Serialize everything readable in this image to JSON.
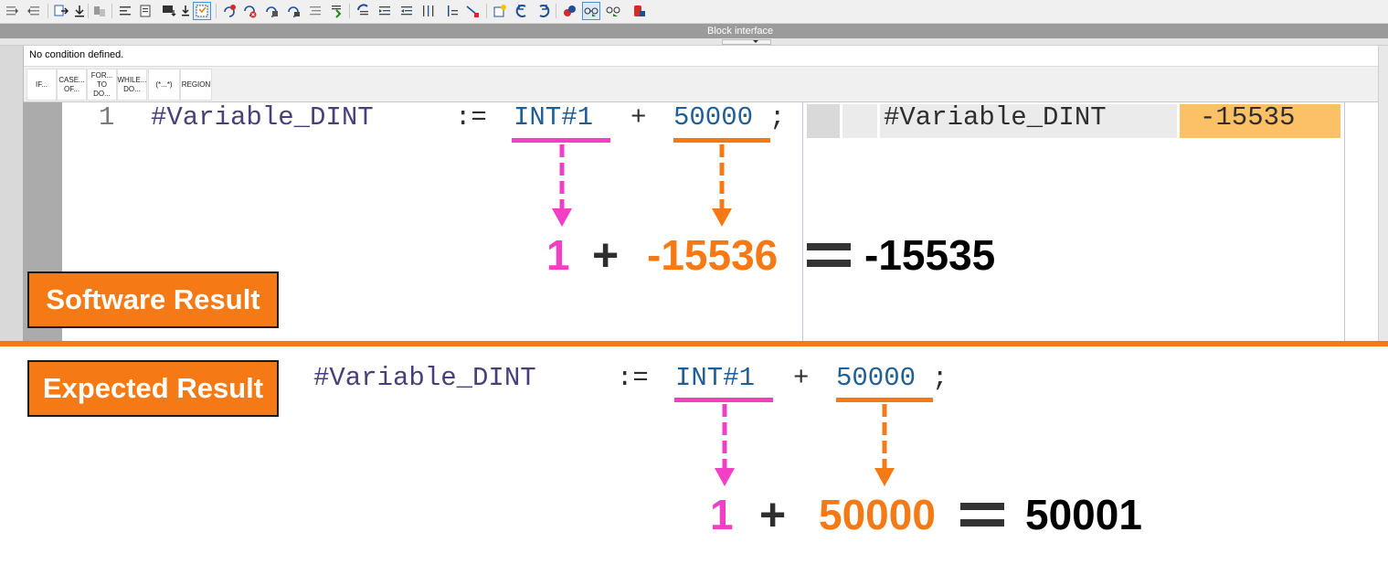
{
  "toolbar": {
    "icons": [
      "indent-increase-icon",
      "indent-decrease-icon",
      "export-icon",
      "compare-icon",
      "align-left-icon",
      "import-block-icon",
      "monitor-download-icon",
      "snippet-select-icon",
      "breakpoint-add-icon",
      "breakpoint-remove-icon",
      "breakpoint-toggle-icon",
      "breakpoint-list-icon",
      "list-icon",
      "step-into-icon",
      "jump-back-icon",
      "jump-forward-icon",
      "indent-icon",
      "outdent-icon",
      "columns-icon",
      "tree-icon",
      "debug-icon",
      "highlight-icon",
      "refresh-icon",
      "back-icon",
      "forward-icon",
      "monitor-icon",
      "watch-icon",
      "watch-table-icon",
      "stop-icon"
    ],
    "active_index": 8
  },
  "panel": {
    "title": "Block interface",
    "condition": "No condition defined."
  },
  "snippets": [
    {
      "line1": "IF...",
      "line2": ""
    },
    {
      "line1": "CASE...",
      "line2": "OF..."
    },
    {
      "line1": "FOR...",
      "line2": "TO DO..."
    },
    {
      "line1": "WHILE...",
      "line2": "DO..."
    },
    {
      "line1": "(*...*)",
      "line2": ""
    },
    {
      "line1": "REGION",
      "line2": ""
    }
  ],
  "code": {
    "line_number": "1",
    "variable": "#Variable_DINT",
    "assign_op": ":=",
    "operand1": "INT#1",
    "plus": "+",
    "operand2": "50000",
    "terminator": ";"
  },
  "watch": {
    "variable": "#Variable_DINT",
    "value": "-15535"
  },
  "software_result": {
    "label": "Software Result",
    "operand1": "1",
    "plus": "+",
    "operand2": "-15536",
    "result": "-15535"
  },
  "expected_result": {
    "label": "Expected Result",
    "operand1": "1",
    "plus": "+",
    "operand2": "50000",
    "result": "50001"
  },
  "colors": {
    "pink": "#f23fc5",
    "orange": "#f57a16",
    "watch_value_bg": "#fcc166",
    "code_variable": "#4b3f7a",
    "code_literal": "#1f5f95"
  }
}
